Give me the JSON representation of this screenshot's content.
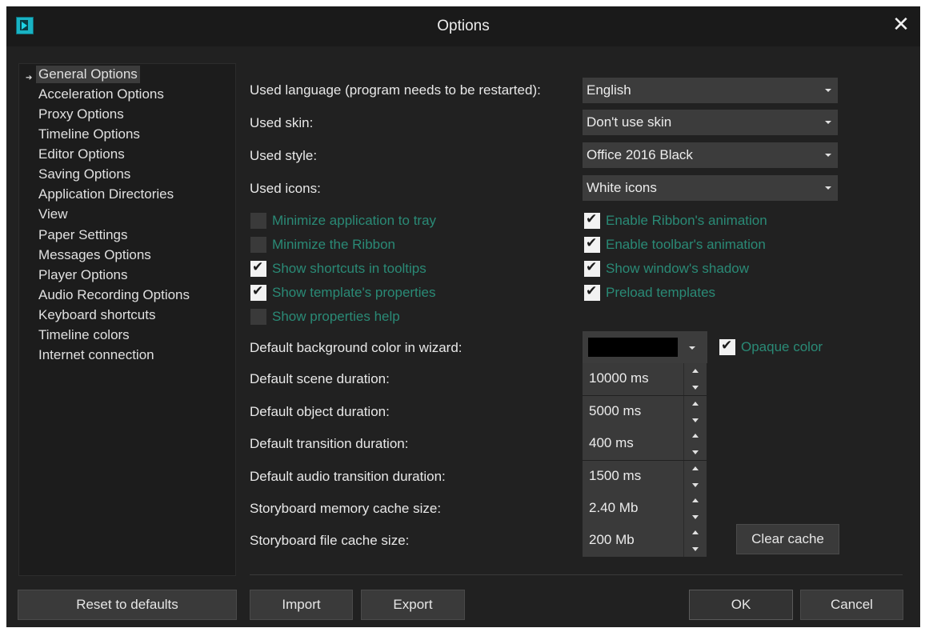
{
  "window": {
    "title": "Options",
    "close_icon": "close-icon"
  },
  "nav": {
    "items": [
      {
        "label": "General Options",
        "selected": true
      },
      {
        "label": "Acceleration Options"
      },
      {
        "label": "Proxy Options"
      },
      {
        "label": "Timeline Options"
      },
      {
        "label": "Editor Options"
      },
      {
        "label": "Saving Options"
      },
      {
        "label": "Application Directories"
      },
      {
        "label": "View"
      },
      {
        "label": "Paper Settings"
      },
      {
        "label": "Messages Options"
      },
      {
        "label": "Player Options"
      },
      {
        "label": "Audio Recording Options"
      },
      {
        "label": "Keyboard shortcuts"
      },
      {
        "label": "Timeline colors"
      },
      {
        "label": "Internet connection"
      }
    ]
  },
  "general": {
    "language": {
      "label": "Used language (program needs to be restarted):",
      "value": "English"
    },
    "skin": {
      "label": "Used skin:",
      "value": "Don't use skin"
    },
    "style": {
      "label": "Used style:",
      "value": "Office 2016 Black"
    },
    "icons": {
      "label": "Used icons:",
      "value": "White icons"
    },
    "checkboxes_left": [
      {
        "label": "Minimize application to tray",
        "checked": false
      },
      {
        "label": "Minimize the Ribbon",
        "checked": false
      },
      {
        "label": "Show shortcuts in tooltips",
        "checked": true
      },
      {
        "label": "Show template's properties",
        "checked": true
      },
      {
        "label": "Show properties help",
        "checked": false
      }
    ],
    "checkboxes_right": [
      {
        "label": "Enable Ribbon's animation",
        "checked": true
      },
      {
        "label": "Enable toolbar's animation",
        "checked": true
      },
      {
        "label": "Show window's shadow",
        "checked": true
      },
      {
        "label": "Preload templates",
        "checked": true
      }
    ],
    "bg_color": {
      "label": "Default background color in wizard:",
      "value": "#000000"
    },
    "opaque": {
      "label": "Opaque color",
      "checked": true
    },
    "durations": [
      {
        "label": "Default scene duration:",
        "value": "10000 ms"
      },
      {
        "label": "Default object duration:",
        "value": "5000 ms"
      },
      {
        "label": "Default transition duration:",
        "value": "400 ms"
      },
      {
        "label": "Default audio transition duration:",
        "value": "1500 ms"
      },
      {
        "label": "Storyboard memory cache size:",
        "value": "2.40 Mb"
      },
      {
        "label": "Storyboard file cache size:",
        "value": "200 Mb"
      }
    ],
    "clear_cache_label": "Clear cache"
  },
  "footer": {
    "reset_label": "Reset to defaults",
    "import_label": "Import",
    "export_label": "Export",
    "ok_label": "OK",
    "cancel_label": "Cancel"
  },
  "colors": {
    "accent_text": "#2a8a76",
    "background": "#212121",
    "control": "#3c3c3c"
  }
}
